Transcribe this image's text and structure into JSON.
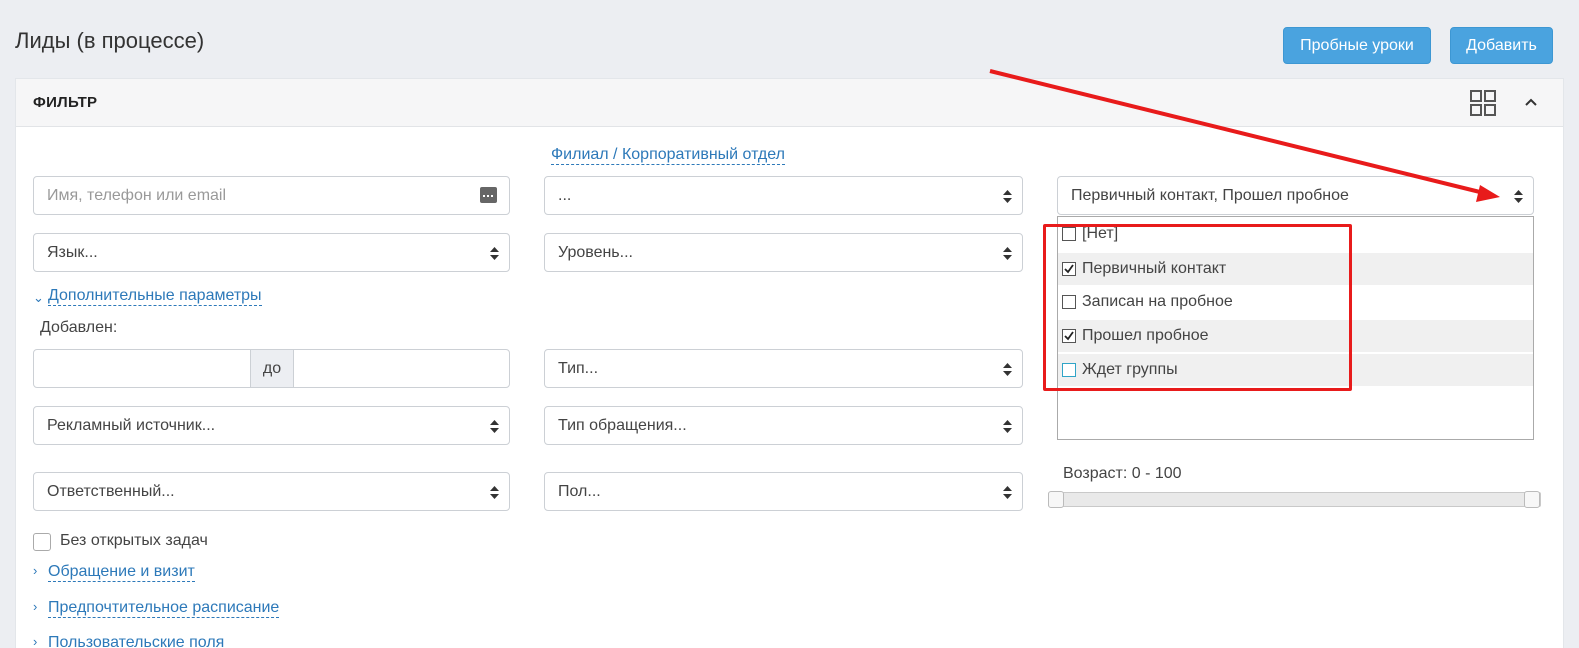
{
  "header": {
    "title": "Лиды (в процессе)",
    "btn_trial": "Пробные уроки",
    "btn_add": "Добавить",
    "accent_color": "#4aa3df"
  },
  "filter": {
    "title": "ФИЛЬТР",
    "branch_link": "Филиал / Корпоративный отдел",
    "search_placeholder": "Имя, телефон или email",
    "branch_select": "...",
    "status_select": "Первичный контакт, Прошел пробное",
    "language": "Язык...",
    "level": "Уровень...",
    "advanced_link": "Дополнительные параметры",
    "added_label": "Добавлен:",
    "to_label": "до",
    "type": "Тип...",
    "ad_source": "Рекламный источник...",
    "request_type": "Тип обращения...",
    "responsible": "Ответственный...",
    "gender": "Пол...",
    "age_label": "Возраст: 0 - 100",
    "age_range": [
      0,
      100
    ],
    "no_tasks_label": "Без открытых задач",
    "link_request": "Обращение и визит",
    "link_schedule": "Предпочтительное расписание",
    "link_custom": "Пользовательские поля"
  },
  "status_options": [
    {
      "label": "[Нет]",
      "checked": false
    },
    {
      "label": "Первичный контакт",
      "checked": true
    },
    {
      "label": "Записан на пробное",
      "checked": false
    },
    {
      "label": "Прошел пробное",
      "checked": true
    },
    {
      "label": "Ждет группы",
      "checked": false
    }
  ],
  "annotation_color": "#e81b1b"
}
